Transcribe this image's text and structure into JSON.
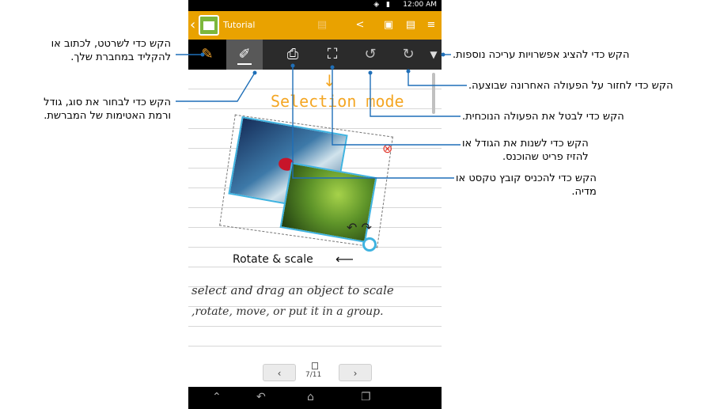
{
  "status_bar": {
    "time": "12:00 AM"
  },
  "app": {
    "title": "Tutorial"
  },
  "canvas": {
    "selection_mode_label": "Selection mode",
    "rotate_label": "Rotate & scale",
    "handwriting_line1": "select and drag an object to scale",
    "handwriting_line2": ",rotate, move, or put it in a group."
  },
  "pager": {
    "page_label": "7/11"
  },
  "callouts": {
    "keyboard": [
      "הקש כדי לשרטט, לכתוב או",
      "להקליד במחברת שלך."
    ],
    "brush": [
      "הקש כדי לבחור את סוג, גודל",
      "ורמת האטימות של המברשת."
    ],
    "more": "הקש כדי להציג אפשרויות עריכה נוספות.",
    "redo": "הקש כדי לחזור על הפעולה האחרונה שבוצעה.",
    "undo": "הקש כדי לבטל את הפעולה הנוכחית.",
    "select": [
      "הקש כדי לשנות את הגודל או",
      "להזיז פריט שהוכנס."
    ],
    "insert": [
      "הקש כדי להכניס קובץ טקסט או",
      "מדיה."
    ]
  },
  "icons": {
    "back": "chevron-left-icon",
    "app": "supernote-app-icon",
    "share": "share-icon",
    "add_page": "add-page-icon",
    "doc_settings": "document-settings-icon",
    "menu": "overflow-menu-icon",
    "keyboard": "keyboard-pen-mode-icon",
    "brush": "brush-icon",
    "insert": "insert-media-icon",
    "select": "selection-mode-icon",
    "undo": "undo-icon",
    "redo": "redo-icon",
    "more": "dropdown-arrow-icon"
  },
  "colors": {
    "accent": "#e9a200",
    "toolbar": "#2b2b2b",
    "selection": "#3fb3e0",
    "callout_line": "#1f6fb8"
  }
}
